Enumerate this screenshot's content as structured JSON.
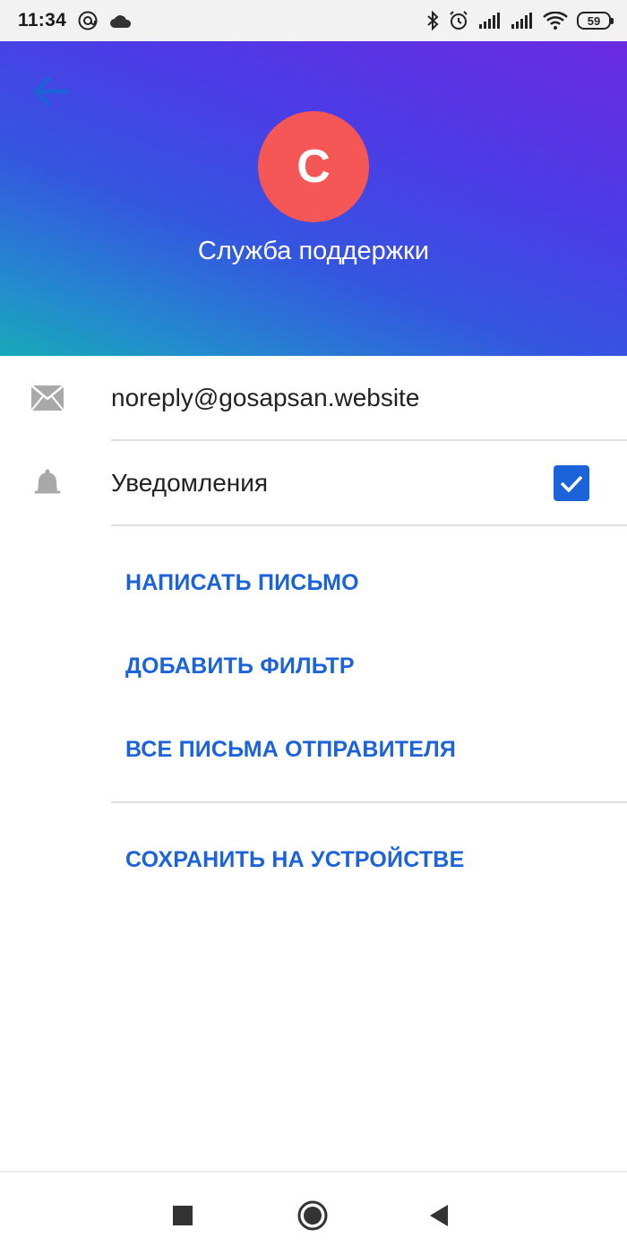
{
  "status_bar": {
    "time": "11:34",
    "battery": "59",
    "icons": [
      "at-sign-icon",
      "cloud-icon",
      "bluetooth-icon",
      "alarm-icon",
      "signal-icon",
      "signal-icon",
      "wifi-icon",
      "battery-icon"
    ]
  },
  "header": {
    "avatar_letter": "C",
    "name": "Служба поддержки",
    "colors": {
      "gradient_start": "#17a9b8",
      "gradient_end": "#6a2ae0",
      "avatar_bg": "#f55656",
      "back_arrow": "#1c63d9"
    }
  },
  "contact": {
    "email": "noreply@gosapsan.website",
    "notifications_label": "Уведомления",
    "notifications_enabled": true
  },
  "actions": {
    "write_email": "НАПИСАТЬ ПИСЬМО",
    "add_filter": "ДОБАВИТЬ ФИЛЬТР",
    "all_sender_emails": "ВСЕ ПИСЬМА ОТПРАВИТЕЛЯ",
    "save_on_device": "СОХРАНИТЬ НА УСТРОЙСТВЕ"
  },
  "accent_color": "#1c63d9",
  "nav_bar": {
    "icons": [
      "square-icon",
      "home-circle-icon",
      "back-triangle-icon"
    ]
  }
}
